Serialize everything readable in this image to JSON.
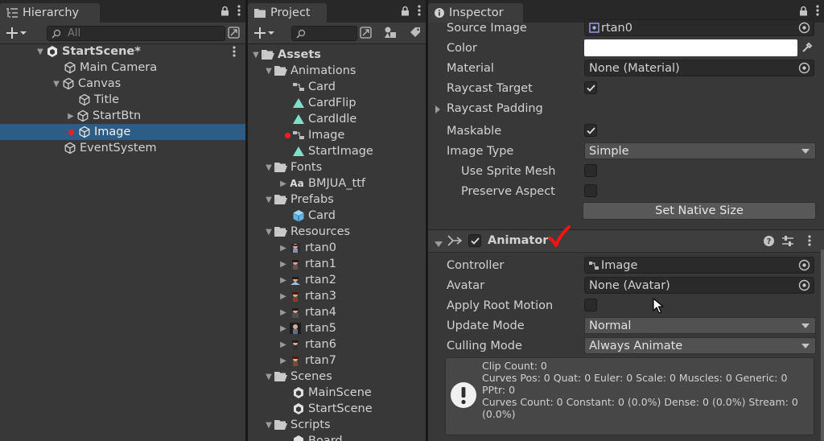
{
  "hierarchy": {
    "tab_title": "Hierarchy",
    "search_placeholder": "All",
    "items": [
      {
        "label": "StartScene*",
        "icon": "unity-scene-icon",
        "expanded": true,
        "bold": true
      },
      {
        "label": "Main Camera",
        "icon": "gameobject-cube-icon"
      },
      {
        "label": "Canvas",
        "icon": "gameobject-cube-icon",
        "expanded": true
      },
      {
        "label": "Title",
        "icon": "gameobject-cube-icon"
      },
      {
        "label": "StartBtn",
        "icon": "gameobject-cube-icon",
        "collapsed": true
      },
      {
        "label": "Image",
        "icon": "gameobject-cube-icon",
        "selected": true,
        "modified_dot": true
      },
      {
        "label": "EventSystem",
        "icon": "gameobject-cube-icon"
      }
    ]
  },
  "project": {
    "tab_title": "Project",
    "items": [
      {
        "label": "Assets",
        "icon": "folder-open-icon",
        "bold": true
      },
      {
        "label": "Animations",
        "icon": "folder-open-icon"
      },
      {
        "label": "Card",
        "icon": "animator-controller-icon"
      },
      {
        "label": "CardFlip",
        "icon": "animation-clip-icon"
      },
      {
        "label": "CardIdle",
        "icon": "animation-clip-icon"
      },
      {
        "label": "Image",
        "icon": "animator-controller-icon",
        "modified_dot": true
      },
      {
        "label": "StartImage",
        "icon": "animation-clip-icon"
      },
      {
        "label": "Fonts",
        "icon": "folder-open-icon"
      },
      {
        "label": "BMJUA_ttf",
        "icon": "font-icon",
        "icon_text": "Aa"
      },
      {
        "label": "Prefabs",
        "icon": "folder-open-icon"
      },
      {
        "label": "Card",
        "icon": "prefab-icon"
      },
      {
        "label": "Resources",
        "icon": "folder-open-icon"
      },
      {
        "label": "rtan0",
        "icon": "sprite-thumbnail-icon"
      },
      {
        "label": "rtan1",
        "icon": "sprite-thumbnail-icon"
      },
      {
        "label": "rtan2",
        "icon": "sprite-thumbnail-icon"
      },
      {
        "label": "rtan3",
        "icon": "sprite-thumbnail-icon"
      },
      {
        "label": "rtan4",
        "icon": "sprite-thumbnail-icon"
      },
      {
        "label": "rtan5",
        "icon": "sprite-thumbnail-icon"
      },
      {
        "label": "rtan6",
        "icon": "sprite-thumbnail-icon"
      },
      {
        "label": "rtan7",
        "icon": "sprite-thumbnail-icon"
      },
      {
        "label": "Scenes",
        "icon": "folder-open-icon"
      },
      {
        "label": "MainScene",
        "icon": "unity-scene-icon"
      },
      {
        "label": "StartScene",
        "icon": "unity-scene-icon"
      },
      {
        "label": "Scripts",
        "icon": "folder-open-icon"
      },
      {
        "label": "Board",
        "icon": "script-icon"
      }
    ]
  },
  "inspector": {
    "tab_title": "Inspector",
    "image": {
      "source_image_label": "Source Image",
      "source_image_value": "rtan0",
      "color_label": "Color",
      "material_label": "Material",
      "material_value": "None (Material)",
      "raycast_target_label": "Raycast Target",
      "raycast_padding_label": "Raycast Padding",
      "maskable_label": "Maskable",
      "image_type_label": "Image Type",
      "image_type_value": "Simple",
      "use_sprite_mesh_label": "Use Sprite Mesh",
      "preserve_aspect_label": "Preserve Aspect",
      "set_native_size_label": "Set Native Size"
    },
    "animator": {
      "title": "Animator",
      "controller_label": "Controller",
      "controller_value": "Image",
      "avatar_label": "Avatar",
      "avatar_value": "None (Avatar)",
      "apply_root_motion_label": "Apply Root Motion",
      "update_mode_label": "Update Mode",
      "update_mode_value": "Normal",
      "culling_mode_label": "Culling Mode",
      "culling_mode_value": "Always Animate",
      "info_lines": [
        "Clip Count: 0",
        "Curves Pos: 0 Quat: 0 Euler: 0 Scale: 0 Muscles: 0 Generic: 0 PPtr: 0",
        "Curves Count: 0 Constant: 0 (0.0%) Dense: 0 (0.0%) Stream: 0 (0.0%)"
      ]
    }
  },
  "colors": {
    "selection": "#2c5d87",
    "panel_bg": "#383838",
    "checkmark_annotation": "#ff1111"
  }
}
